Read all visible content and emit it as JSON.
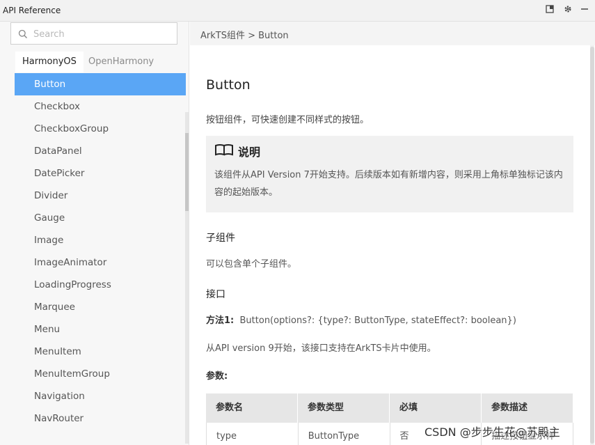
{
  "window": {
    "title": "API Reference",
    "icons": [
      "restore-icon",
      "gear-icon",
      "minimize-icon"
    ]
  },
  "sidebar": {
    "search": {
      "placeholder": "Search",
      "value": ""
    },
    "tabs": [
      {
        "label": "HarmonyOS",
        "active": true
      },
      {
        "label": "OpenHarmony",
        "active": false
      }
    ],
    "items": [
      {
        "label": "Button",
        "selected": true
      },
      {
        "label": "Checkbox"
      },
      {
        "label": "CheckboxGroup"
      },
      {
        "label": "DataPanel"
      },
      {
        "label": "DatePicker"
      },
      {
        "label": "Divider"
      },
      {
        "label": "Gauge"
      },
      {
        "label": "Image"
      },
      {
        "label": "ImageAnimator"
      },
      {
        "label": "LoadingProgress"
      },
      {
        "label": "Marquee"
      },
      {
        "label": "Menu"
      },
      {
        "label": "MenuItem"
      },
      {
        "label": "MenuItemGroup"
      },
      {
        "label": "Navigation"
      },
      {
        "label": "NavRouter"
      }
    ]
  },
  "breadcrumb": "ArkTS组件 > Button",
  "content": {
    "title": "Button",
    "description": "按钮组件，可快速创建不同样式的按钮。",
    "note": {
      "title": "说明",
      "body": "该组件从API Version 7开始支持。后续版本如有新增内容，则采用上角标单独标记该内容的起始版本。"
    },
    "section_children": {
      "heading": "子组件",
      "text": "可以包含单个子组件。"
    },
    "section_interface": {
      "heading": "接口",
      "method_label": "方法1:",
      "method_sig": "Button(options?: {type?: ButtonType, stateEffect?: boolean})",
      "since": "从API version 9开始，该接口支持在ArkTS卡片中使用。",
      "params_label": "参数:"
    },
    "table": {
      "headers": [
        "参数名",
        "参数类型",
        "必填",
        "参数描述"
      ],
      "rows": [
        [
          "type",
          "ButtonType",
          "否",
          "描述按钮显示样"
        ]
      ]
    }
  },
  "watermark": "CSDN @步步生花@苏殿主",
  "colors": {
    "selected": "#5aa6f5",
    "note_bg": "#f1f1f1",
    "table_head": "#e6e6e6"
  }
}
